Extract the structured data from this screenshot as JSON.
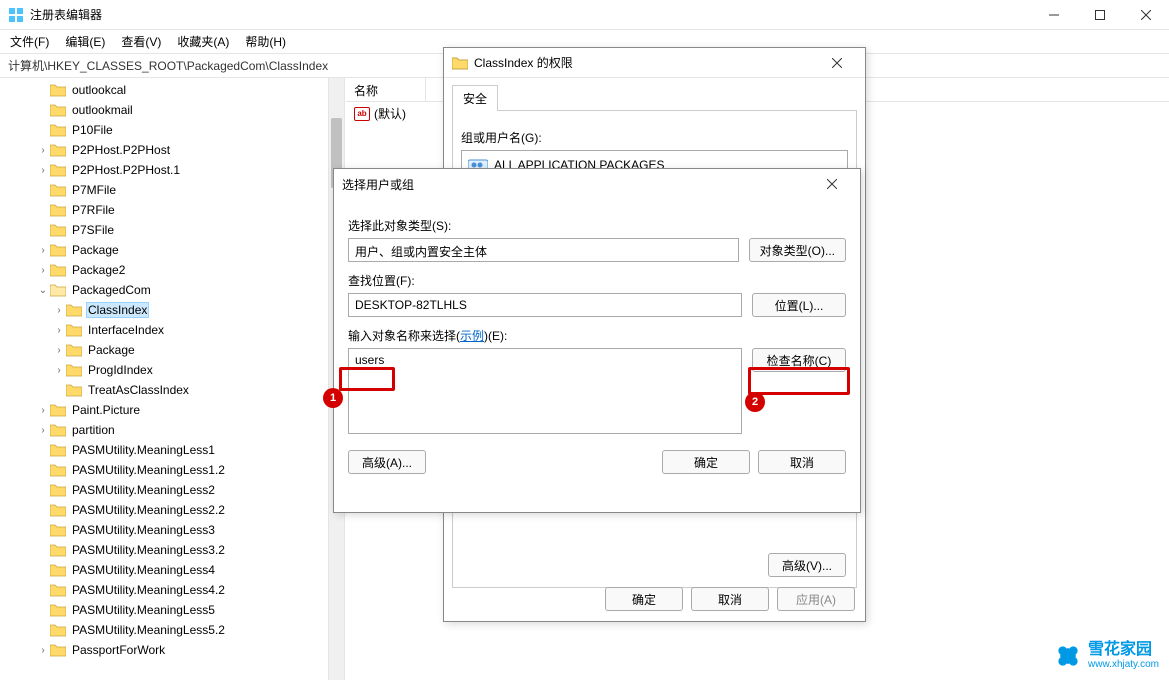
{
  "window": {
    "title": "注册表编辑器",
    "menu": {
      "file": "文件(F)",
      "edit": "编辑(E)",
      "view": "查看(V)",
      "fav": "收藏夹(A)",
      "help": "帮助(H)"
    },
    "address": "计算机\\HKEY_CLASSES_ROOT\\PackagedCom\\ClassIndex"
  },
  "list": {
    "col_name": "名称",
    "default_row": "(默认)"
  },
  "tree": [
    {
      "lvl": 1,
      "exp": "",
      "label": "outlookcal"
    },
    {
      "lvl": 1,
      "exp": "",
      "label": "outlookmail"
    },
    {
      "lvl": 1,
      "exp": "",
      "label": "P10File"
    },
    {
      "lvl": 1,
      "exp": ">",
      "label": "P2PHost.P2PHost"
    },
    {
      "lvl": 1,
      "exp": ">",
      "label": "P2PHost.P2PHost.1"
    },
    {
      "lvl": 1,
      "exp": "",
      "label": "P7MFile"
    },
    {
      "lvl": 1,
      "exp": "",
      "label": "P7RFile"
    },
    {
      "lvl": 1,
      "exp": "",
      "label": "P7SFile"
    },
    {
      "lvl": 1,
      "exp": ">",
      "label": "Package"
    },
    {
      "lvl": 1,
      "exp": ">",
      "label": "Package2"
    },
    {
      "lvl": 1,
      "exp": "v",
      "label": "PackagedCom",
      "open": true
    },
    {
      "lvl": 2,
      "exp": ">",
      "label": "ClassIndex",
      "selected": true
    },
    {
      "lvl": 2,
      "exp": ">",
      "label": "InterfaceIndex"
    },
    {
      "lvl": 2,
      "exp": ">",
      "label": "Package"
    },
    {
      "lvl": 2,
      "exp": ">",
      "label": "ProgIdIndex"
    },
    {
      "lvl": 2,
      "exp": "",
      "label": "TreatAsClassIndex"
    },
    {
      "lvl": 1,
      "exp": ">",
      "label": "Paint.Picture"
    },
    {
      "lvl": 1,
      "exp": ">",
      "label": "partition"
    },
    {
      "lvl": 1,
      "exp": "",
      "label": "PASMUtility.MeaningLess1"
    },
    {
      "lvl": 1,
      "exp": "",
      "label": "PASMUtility.MeaningLess1.2"
    },
    {
      "lvl": 1,
      "exp": "",
      "label": "PASMUtility.MeaningLess2"
    },
    {
      "lvl": 1,
      "exp": "",
      "label": "PASMUtility.MeaningLess2.2"
    },
    {
      "lvl": 1,
      "exp": "",
      "label": "PASMUtility.MeaningLess3"
    },
    {
      "lvl": 1,
      "exp": "",
      "label": "PASMUtility.MeaningLess3.2"
    },
    {
      "lvl": 1,
      "exp": "",
      "label": "PASMUtility.MeaningLess4"
    },
    {
      "lvl": 1,
      "exp": "",
      "label": "PASMUtility.MeaningLess4.2"
    },
    {
      "lvl": 1,
      "exp": "",
      "label": "PASMUtility.MeaningLess5"
    },
    {
      "lvl": 1,
      "exp": "",
      "label": "PASMUtility.MeaningLess5.2"
    },
    {
      "lvl": 1,
      "exp": ">",
      "label": "PassportForWork"
    }
  ],
  "perm_dialog": {
    "title": "ClassIndex 的权限",
    "tab_security": "安全",
    "groups_label": "组或用户名(G):",
    "group_all_packages": "ALL APPLICATION PACKAGES",
    "btn_advanced_hidden": "高级(V)...",
    "btn_ok": "确定",
    "btn_cancel": "取消",
    "btn_apply": "应用(A)"
  },
  "sel_dialog": {
    "title": "选择用户或组",
    "obj_type_label": "选择此对象类型(S):",
    "obj_type_value": "用户、组或内置安全主体",
    "btn_obj_type": "对象类型(O)...",
    "location_label": "查找位置(F):",
    "location_value": "DESKTOP-82TLHLS",
    "btn_location": "位置(L)...",
    "names_label_pre": "输入对象名称来选择(",
    "names_label_link": "示例",
    "names_label_post": ")(E):",
    "names_value": "users",
    "btn_check": "检查名称(C)",
    "btn_advanced": "高级(A)...",
    "btn_ok": "确定",
    "btn_cancel": "取消"
  },
  "callouts": {
    "n1": "1",
    "n2": "2"
  },
  "watermark": {
    "big": "雪花家园",
    "small": "www.xhjaty.com"
  }
}
